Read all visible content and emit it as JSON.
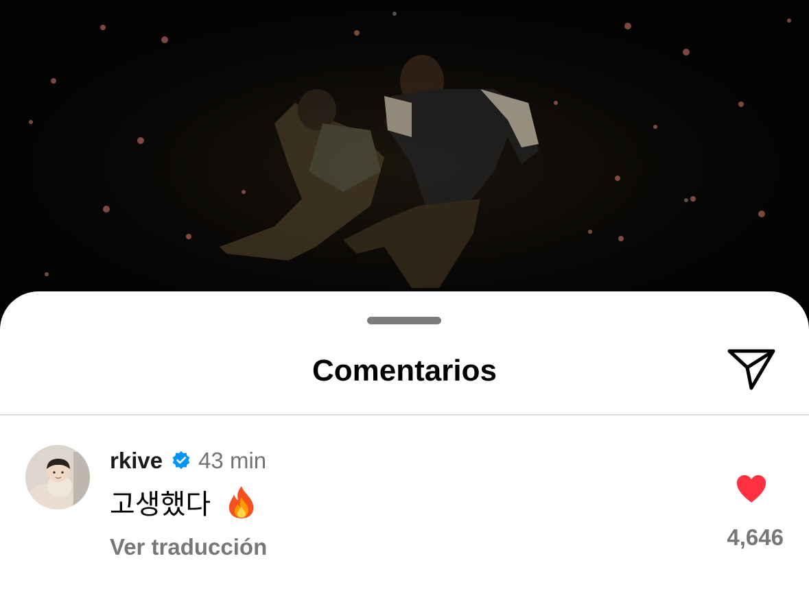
{
  "post_image": {
    "description_icon": "photo-of-performers"
  },
  "comments_sheet": {
    "title": "Comentarios",
    "share_icon": "paper-plane-icon"
  },
  "comment": {
    "username": "rkive",
    "verified_icon": "verified-badge-icon",
    "time": "43 min",
    "text": "고생했다",
    "emoji": "fire-emoji",
    "translate_label": "Ver traducción",
    "like_icon": "heart-icon",
    "like_count": "4,646",
    "liked": true
  },
  "colors": {
    "heart": "#FF3040",
    "verified": "#0095F6",
    "secondary_text": "#737373"
  }
}
